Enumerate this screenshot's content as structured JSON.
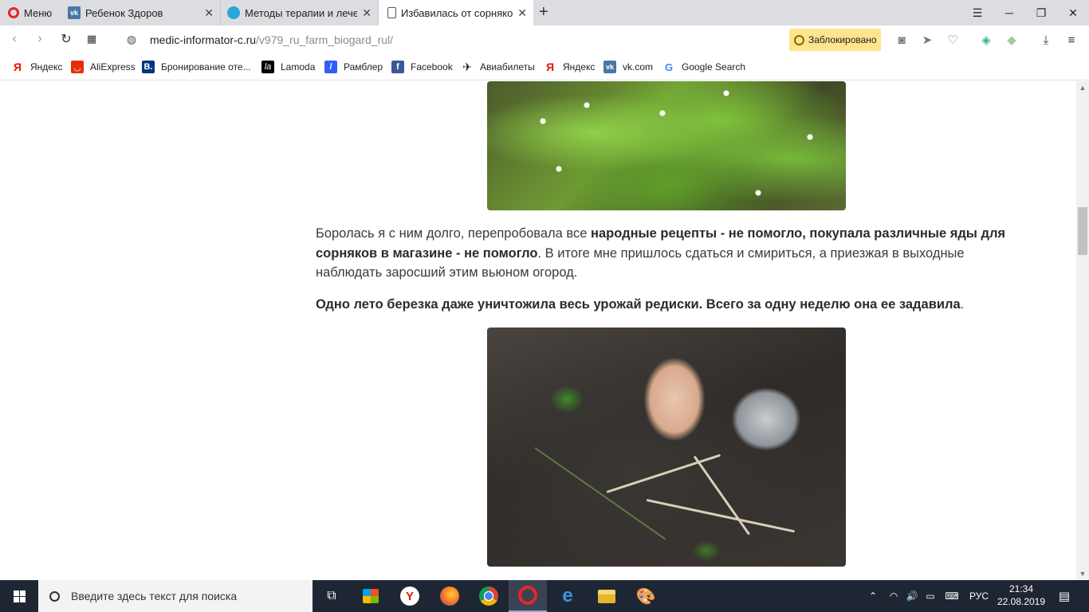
{
  "browser": {
    "menu_label": "Меню",
    "tabs": [
      {
        "label": "Ребенок Здоров",
        "favicon": "vk-icon",
        "color": "#4a76a8"
      },
      {
        "label": "Методы терапии и лечени",
        "favicon": "site-icon",
        "color": "#29a7d8"
      },
      {
        "label": "Избавилась от сорняков н",
        "favicon": "page-icon",
        "color": "#555555"
      }
    ],
    "new_tab": "+",
    "window_controls": [
      "minimize",
      "maximize",
      "close"
    ],
    "url_host": "medic-informator-c.ru",
    "url_path": "/v979_ru_farm_biogard_rul/",
    "blocked_label": "Заблокировано"
  },
  "bookmarks": [
    {
      "label": "Яндекс",
      "icon": "yandex-icon",
      "color": "#e61400"
    },
    {
      "label": "AliExpress",
      "icon": "aliexpress-icon",
      "color": "#e62e04"
    },
    {
      "label": "Бронирование оте...",
      "icon": "booking-icon",
      "color": "#003580"
    },
    {
      "label": "Lamoda",
      "icon": "lamoda-icon",
      "color": "#000000"
    },
    {
      "label": "Рамблер",
      "icon": "rambler-icon",
      "color": "#315efb"
    },
    {
      "label": "Facebook",
      "icon": "facebook-icon",
      "color": "#3b5998"
    },
    {
      "label": "Авиабилеты",
      "icon": "plane-icon",
      "color": "#222222"
    },
    {
      "label": "Яндекс",
      "icon": "yandex-icon",
      "color": "#e61400"
    },
    {
      "label": "vk.com",
      "icon": "vk-icon",
      "color": "#4a76a8"
    },
    {
      "label": "Google Search",
      "icon": "google-icon",
      "color": "#4285f4"
    }
  ],
  "article": {
    "p1_a": "Боролась я с ним долго, перепробовала все ",
    "p1_b": "народные рецепты - не помогло, покупала различные яды для сорняков в магазине - не помогло",
    "p1_c": ". В итоге мне пришлось сдаться и смириться, а приезжая в выходные наблюдать заросший этим вьюном огород.",
    "p2_b": "Одно лето березка даже уничтожила весь урожай редиски. Всего за одну неделю она ее задавила",
    "p2_c": "."
  },
  "taskbar": {
    "search_placeholder": "Введите здесь текст для поиска",
    "apps": [
      "task-view-icon",
      "store-icon",
      "yandex-browser-icon",
      "firefox-icon",
      "chrome-icon",
      "opera-icon",
      "edge-icon",
      "file-explorer-icon",
      "paint-icon"
    ],
    "language": "РУС",
    "time": "21:34",
    "date": "22.08.2019"
  }
}
